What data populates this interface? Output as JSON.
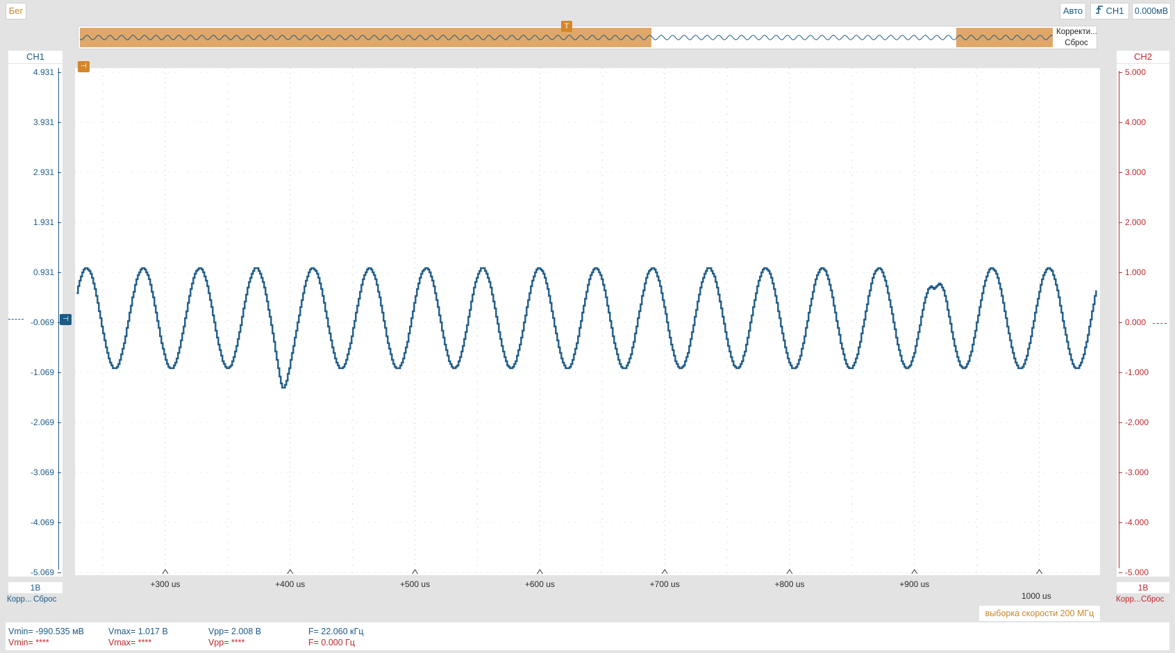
{
  "toolbar": {
    "run_label": "Бег",
    "mode_label": "Авто",
    "trigger_channel_label": "CH1",
    "trigger_level_label": "0.000мВ"
  },
  "overview": {
    "correct_label": "Корректи...",
    "reset_label": "Сброс",
    "trigger_marker": "T",
    "highlight_color": "#e0a868"
  },
  "ch1": {
    "name": "CH1",
    "color": "#1d5a86",
    "scale_label": "1В",
    "correct_label": "Корр...",
    "reset_label": "Сброс",
    "ticks": [
      "4.931",
      "3.931",
      "2.931",
      "1.931",
      "0.931",
      "-0.069",
      "-1.069",
      "-2.069",
      "-3.069",
      "-4.069",
      "-5.069"
    ]
  },
  "ch2": {
    "name": "CH2",
    "color": "#c0282d",
    "scale_label": "1В",
    "correct_label": "Корр...",
    "reset_label": "Сброс",
    "ticks": [
      "5.000",
      "4.000",
      "3.000",
      "2.000",
      "1.000",
      "0.000",
      "-1.000",
      "-2.000",
      "-3.000",
      "-4.000",
      "-5.000"
    ]
  },
  "time_axis": {
    "ticks": [
      "+300 us",
      "+400 us",
      "+500 us",
      "+600 us",
      "+700 us",
      "+800 us",
      "+900 us"
    ],
    "end_label": "1000 us"
  },
  "sample_rate_label": "выборка скорости 200 МГц",
  "measurements": {
    "ch1": {
      "vmin": "Vmin= -990.535 мВ",
      "vmax": "Vmax= 1.017 В",
      "vpp": "Vpp= 2.008 В",
      "freq": "F= 22.060 кГц"
    },
    "ch2": {
      "vmin": "Vmin= ****",
      "vmax": "Vmax= ****",
      "vpp": "Vpp= ****",
      "freq": "F= 0.000 Гц"
    }
  },
  "chart_data": {
    "type": "line",
    "series": [
      {
        "name": "CH1",
        "color": "#1d5a86",
        "min_v": -0.99,
        "max_v": 1.017,
        "frequency_khz": 22.06,
        "glitches_at_us": [
          394,
          916
        ]
      }
    ],
    "x_start_us": 229,
    "x_end_us": 1052,
    "ylim": [
      -5.069,
      4.931
    ]
  }
}
